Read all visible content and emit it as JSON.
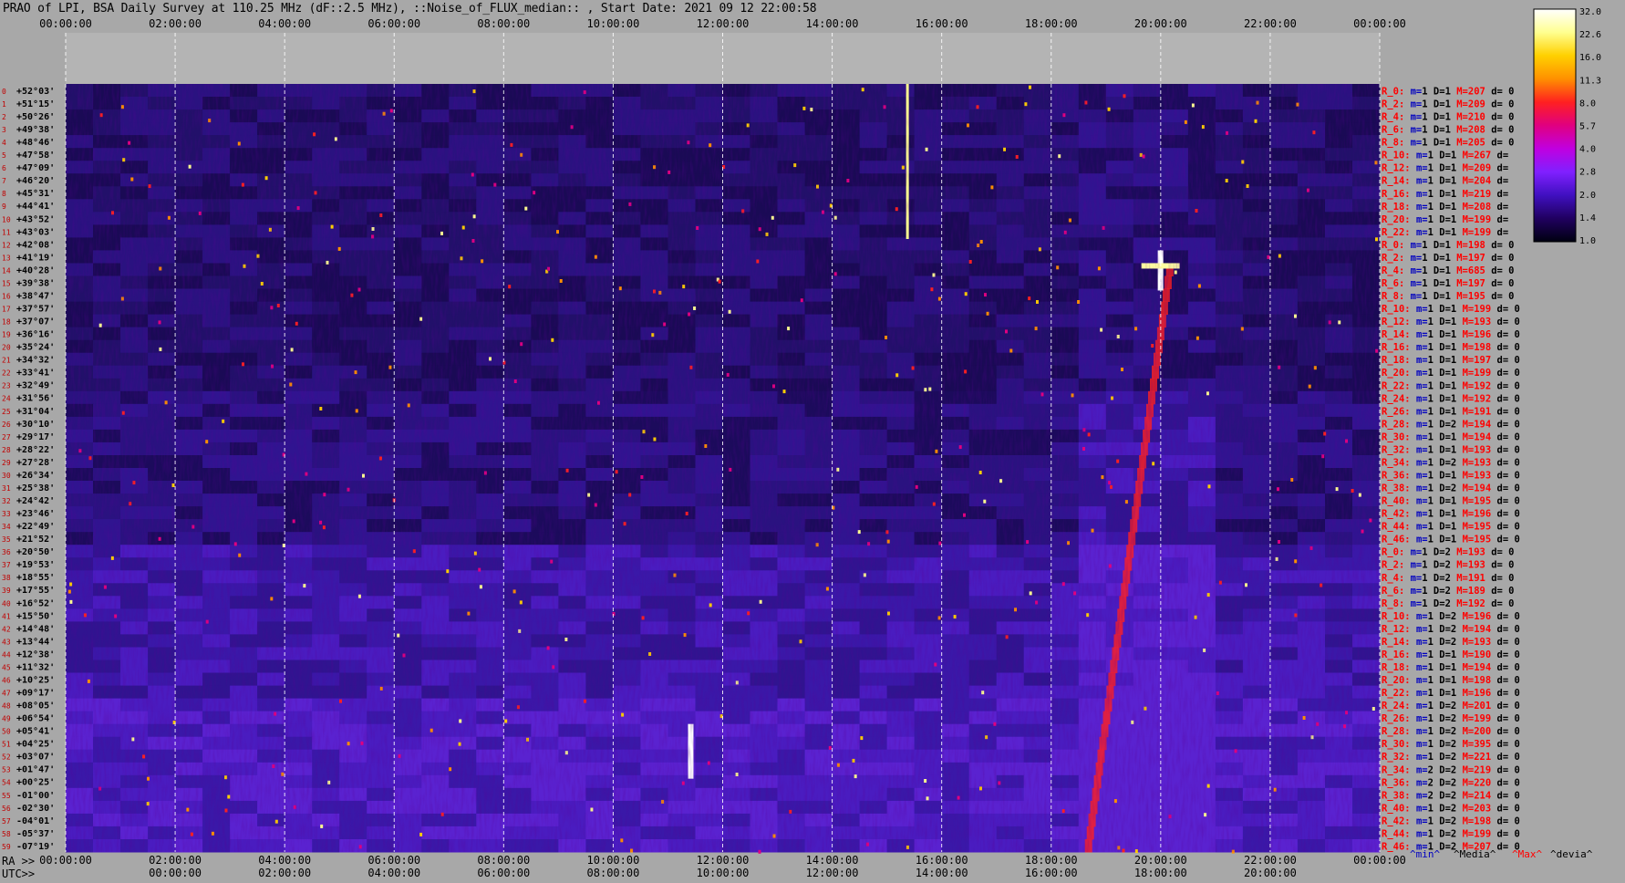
{
  "title": "PRAO of LPI, BSA Daily Survey at 110.25 MHz (dF::2.5 MHz), ::Noise_of_FLUX_median:: , Start Date: 2021 09 12 22:00:58",
  "axes": {
    "top_ticks": [
      "00:00:00",
      "02:00:00",
      "04:00:00",
      "06:00:00",
      "08:00:00",
      "10:00:00",
      "12:00:00",
      "14:00:00",
      "16:00:00",
      "18:00:00",
      "20:00:00",
      "22:00:00",
      "00:00:00"
    ],
    "ra_prefix": "RA >>",
    "utc_prefix": "UTC>>",
    "ra_ticks": [
      "00:00:00",
      "02:00:00",
      "04:00:00",
      "06:00:00",
      "08:00:00",
      "10:00:00",
      "12:00:00",
      "14:00:00",
      "16:00:00",
      "18:00:00",
      "20:00:00",
      "22:00:00",
      "00:00:00"
    ],
    "utc_ticks": [
      "00:00:00",
      "02:00:00",
      "04:00:00",
      "06:00:00",
      "08:00:00",
      "10:00:00",
      "12:00:00",
      "14:00:00",
      "16:00:00",
      "18:00:00",
      "20:00:00"
    ]
  },
  "colorbar": {
    "labels": [
      "32.0",
      "22.6",
      "16.0",
      "11.3",
      "8.0",
      "5.7",
      "4.0",
      "2.8",
      "2.0",
      "1.4",
      "1.0"
    ],
    "colors": [
      "#ffffff",
      "#ffff90",
      "#ffd000",
      "#ff9000",
      "#ff2020",
      "#e00080",
      "#c000e0",
      "#8020ff",
      "#4010c0",
      "#200060",
      "#000010"
    ]
  },
  "legend": [
    {
      "text": "^min^",
      "color": "#0000c0"
    },
    {
      "text": "^Media^",
      "color": "#000000"
    },
    {
      "text": "^Max^",
      "color": "#ff0000"
    },
    {
      "text": "^devia^",
      "color": "#000000"
    }
  ],
  "chart_data": {
    "type": "heatmap",
    "x_range_hours": [
      0,
      24
    ],
    "beam_rows": [
      {
        "idx": "0",
        "dec": "+52°03'",
        "r": "R_0:",
        "m": "1",
        "D": "1",
        "M": "207",
        "d": "0"
      },
      {
        "idx": "1",
        "dec": "+51°15'",
        "r": "R_2:",
        "m": "1",
        "D": "1",
        "M": "209",
        "d": "0"
      },
      {
        "idx": "2",
        "dec": "+50°26'",
        "r": "R_4:",
        "m": "1",
        "D": "1",
        "M": "210",
        "d": "0"
      },
      {
        "idx": "3",
        "dec": "+49°38'",
        "r": "R_6:",
        "m": "1",
        "D": "1",
        "M": "208",
        "d": "0"
      },
      {
        "idx": "4",
        "dec": "+48°46'",
        "r": "R_8:",
        "m": "1",
        "D": "1",
        "M": "205",
        "d": "0"
      },
      {
        "idx": "5",
        "dec": "+47°58'",
        "r": "R_10:",
        "m": "1",
        "D": "1",
        "M": "267",
        "d": ""
      },
      {
        "idx": "6",
        "dec": "+47°09'",
        "r": "R_12:",
        "m": "1",
        "D": "1",
        "M": "209",
        "d": ""
      },
      {
        "idx": "7",
        "dec": "+46°20'",
        "r": "R_14:",
        "m": "1",
        "D": "1",
        "M": "204",
        "d": ""
      },
      {
        "idx": "8",
        "dec": "+45°31'",
        "r": "R_16:",
        "m": "1",
        "D": "1",
        "M": "219",
        "d": ""
      },
      {
        "idx": "9",
        "dec": "+44°41'",
        "r": "R_18:",
        "m": "1",
        "D": "1",
        "M": "208",
        "d": ""
      },
      {
        "idx": "10",
        "dec": "+43°52'",
        "r": "R_20:",
        "m": "1",
        "D": "1",
        "M": "199",
        "d": ""
      },
      {
        "idx": "11",
        "dec": "+43°03'",
        "r": "R_22:",
        "m": "1",
        "D": "1",
        "M": "199",
        "d": ""
      },
      {
        "idx": "12",
        "dec": "+42°08'",
        "r": "R_0:",
        "m": "1",
        "D": "1",
        "M": "198",
        "d": "0"
      },
      {
        "idx": "13",
        "dec": "+41°19'",
        "r": "R_2:",
        "m": "1",
        "D": "1",
        "M": "197",
        "d": "0"
      },
      {
        "idx": "14",
        "dec": "+40°28'",
        "r": "R_4:",
        "m": "1",
        "D": "1",
        "M": "685",
        "d": "0"
      },
      {
        "idx": "15",
        "dec": "+39°38'",
        "r": "R_6:",
        "m": "1",
        "D": "1",
        "M": "197",
        "d": "0"
      },
      {
        "idx": "16",
        "dec": "+38°47'",
        "r": "R_8:",
        "m": "1",
        "D": "1",
        "M": "195",
        "d": "0"
      },
      {
        "idx": "17",
        "dec": "+37°57'",
        "r": "R_10:",
        "m": "1",
        "D": "1",
        "M": "199",
        "d": "0"
      },
      {
        "idx": "18",
        "dec": "+37°07'",
        "r": "R_12:",
        "m": "1",
        "D": "1",
        "M": "193",
        "d": "0"
      },
      {
        "idx": "19",
        "dec": "+36°16'",
        "r": "R_14:",
        "m": "1",
        "D": "1",
        "M": "196",
        "d": "0"
      },
      {
        "idx": "20",
        "dec": "+35°24'",
        "r": "R_16:",
        "m": "1",
        "D": "1",
        "M": "198",
        "d": "0"
      },
      {
        "idx": "21",
        "dec": "+34°32'",
        "r": "R_18:",
        "m": "1",
        "D": "1",
        "M": "197",
        "d": "0"
      },
      {
        "idx": "22",
        "dec": "+33°41'",
        "r": "R_20:",
        "m": "1",
        "D": "1",
        "M": "199",
        "d": "0"
      },
      {
        "idx": "23",
        "dec": "+32°49'",
        "r": "R_22:",
        "m": "1",
        "D": "1",
        "M": "192",
        "d": "0"
      },
      {
        "idx": "24",
        "dec": "+31°56'",
        "r": "R_24:",
        "m": "1",
        "D": "1",
        "M": "192",
        "d": "0"
      },
      {
        "idx": "25",
        "dec": "+31°04'",
        "r": "R_26:",
        "m": "1",
        "D": "1",
        "M": "191",
        "d": "0"
      },
      {
        "idx": "26",
        "dec": "+30°10'",
        "r": "R_28:",
        "m": "1",
        "D": "2",
        "M": "194",
        "d": "0"
      },
      {
        "idx": "27",
        "dec": "+29°17'",
        "r": "R_30:",
        "m": "1",
        "D": "1",
        "M": "194",
        "d": "0"
      },
      {
        "idx": "28",
        "dec": "+28°22'",
        "r": "R_32:",
        "m": "1",
        "D": "1",
        "M": "193",
        "d": "0"
      },
      {
        "idx": "29",
        "dec": "+27°28'",
        "r": "R_34:",
        "m": "1",
        "D": "2",
        "M": "193",
        "d": "0"
      },
      {
        "idx": "30",
        "dec": "+26°34'",
        "r": "R_36:",
        "m": "1",
        "D": "1",
        "M": "193",
        "d": "0"
      },
      {
        "idx": "31",
        "dec": "+25°38'",
        "r": "R_38:",
        "m": "1",
        "D": "2",
        "M": "194",
        "d": "0"
      },
      {
        "idx": "32",
        "dec": "+24°42'",
        "r": "R_40:",
        "m": "1",
        "D": "1",
        "M": "195",
        "d": "0"
      },
      {
        "idx": "33",
        "dec": "+23°46'",
        "r": "R_42:",
        "m": "1",
        "D": "1",
        "M": "196",
        "d": "0"
      },
      {
        "idx": "34",
        "dec": "+22°49'",
        "r": "R_44:",
        "m": "1",
        "D": "1",
        "M": "195",
        "d": "0"
      },
      {
        "idx": "35",
        "dec": "+21°52'",
        "r": "R_46:",
        "m": "1",
        "D": "1",
        "M": "195",
        "d": "0"
      },
      {
        "idx": "36",
        "dec": "+20°50'",
        "r": "R_0:",
        "m": "1",
        "D": "2",
        "M": "193",
        "d": "0"
      },
      {
        "idx": "37",
        "dec": "+19°53'",
        "r": "R_2:",
        "m": "1",
        "D": "2",
        "M": "193",
        "d": "0"
      },
      {
        "idx": "38",
        "dec": "+18°55'",
        "r": "R_4:",
        "m": "1",
        "D": "2",
        "M": "191",
        "d": "0"
      },
      {
        "idx": "39",
        "dec": "+17°55'",
        "r": "R_6:",
        "m": "1",
        "D": "2",
        "M": "189",
        "d": "0"
      },
      {
        "idx": "40",
        "dec": "+16°52'",
        "r": "R_8:",
        "m": "1",
        "D": "2",
        "M": "192",
        "d": "0"
      },
      {
        "idx": "41",
        "dec": "+15°50'",
        "r": "R_10:",
        "m": "1",
        "D": "2",
        "M": "196",
        "d": "0"
      },
      {
        "idx": "42",
        "dec": "+14°48'",
        "r": "R_12:",
        "m": "1",
        "D": "2",
        "M": "194",
        "d": "0"
      },
      {
        "idx": "43",
        "dec": "+13°44'",
        "r": "R_14:",
        "m": "1",
        "D": "2",
        "M": "193",
        "d": "0"
      },
      {
        "idx": "44",
        "dec": "+12°38'",
        "r": "R_16:",
        "m": "1",
        "D": "1",
        "M": "190",
        "d": "0"
      },
      {
        "idx": "45",
        "dec": "+11°32'",
        "r": "R_18:",
        "m": "1",
        "D": "1",
        "M": "194",
        "d": "0"
      },
      {
        "idx": "46",
        "dec": "+10°25'",
        "r": "R_20:",
        "m": "1",
        "D": "1",
        "M": "198",
        "d": "0"
      },
      {
        "idx": "47",
        "dec": "+09°17'",
        "r": "R_22:",
        "m": "1",
        "D": "1",
        "M": "196",
        "d": "0"
      },
      {
        "idx": "48",
        "dec": "+08°05'",
        "r": "R_24:",
        "m": "1",
        "D": "2",
        "M": "201",
        "d": "0"
      },
      {
        "idx": "49",
        "dec": "+06°54'",
        "r": "R_26:",
        "m": "1",
        "D": "2",
        "M": "199",
        "d": "0"
      },
      {
        "idx": "50",
        "dec": "+05°41'",
        "r": "R_28:",
        "m": "1",
        "D": "2",
        "M": "200",
        "d": "0"
      },
      {
        "idx": "51",
        "dec": "+04°25'",
        "r": "R_30:",
        "m": "1",
        "D": "2",
        "M": "395",
        "d": "0"
      },
      {
        "idx": "52",
        "dec": "+03°07'",
        "r": "R_32:",
        "m": "1",
        "D": "2",
        "M": "221",
        "d": "0"
      },
      {
        "idx": "53",
        "dec": "+01°47'",
        "r": "R_34:",
        "m": "2",
        "D": "2",
        "M": "219",
        "d": "0"
      },
      {
        "idx": "54",
        "dec": "+00°25'",
        "r": "R_36:",
        "m": "2",
        "D": "2",
        "M": "220",
        "d": "0"
      },
      {
        "idx": "55",
        "dec": "-01°00'",
        "r": "R_38:",
        "m": "2",
        "D": "2",
        "M": "214",
        "d": "0"
      },
      {
        "idx": "56",
        "dec": "-02°30'",
        "r": "R_40:",
        "m": "1",
        "D": "2",
        "M": "203",
        "d": "0"
      },
      {
        "idx": "57",
        "dec": "-04°01'",
        "r": "R_42:",
        "m": "1",
        "D": "2",
        "M": "198",
        "d": "0"
      },
      {
        "idx": "58",
        "dec": "-05°37'",
        "r": "R_44:",
        "m": "1",
        "D": "2",
        "M": "199",
        "d": "0"
      },
      {
        "idx": "59",
        "dec": "-07°19'",
        "r": "R_46:",
        "m": "1",
        "D": "2",
        "M": "207",
        "d": "0"
      }
    ]
  }
}
